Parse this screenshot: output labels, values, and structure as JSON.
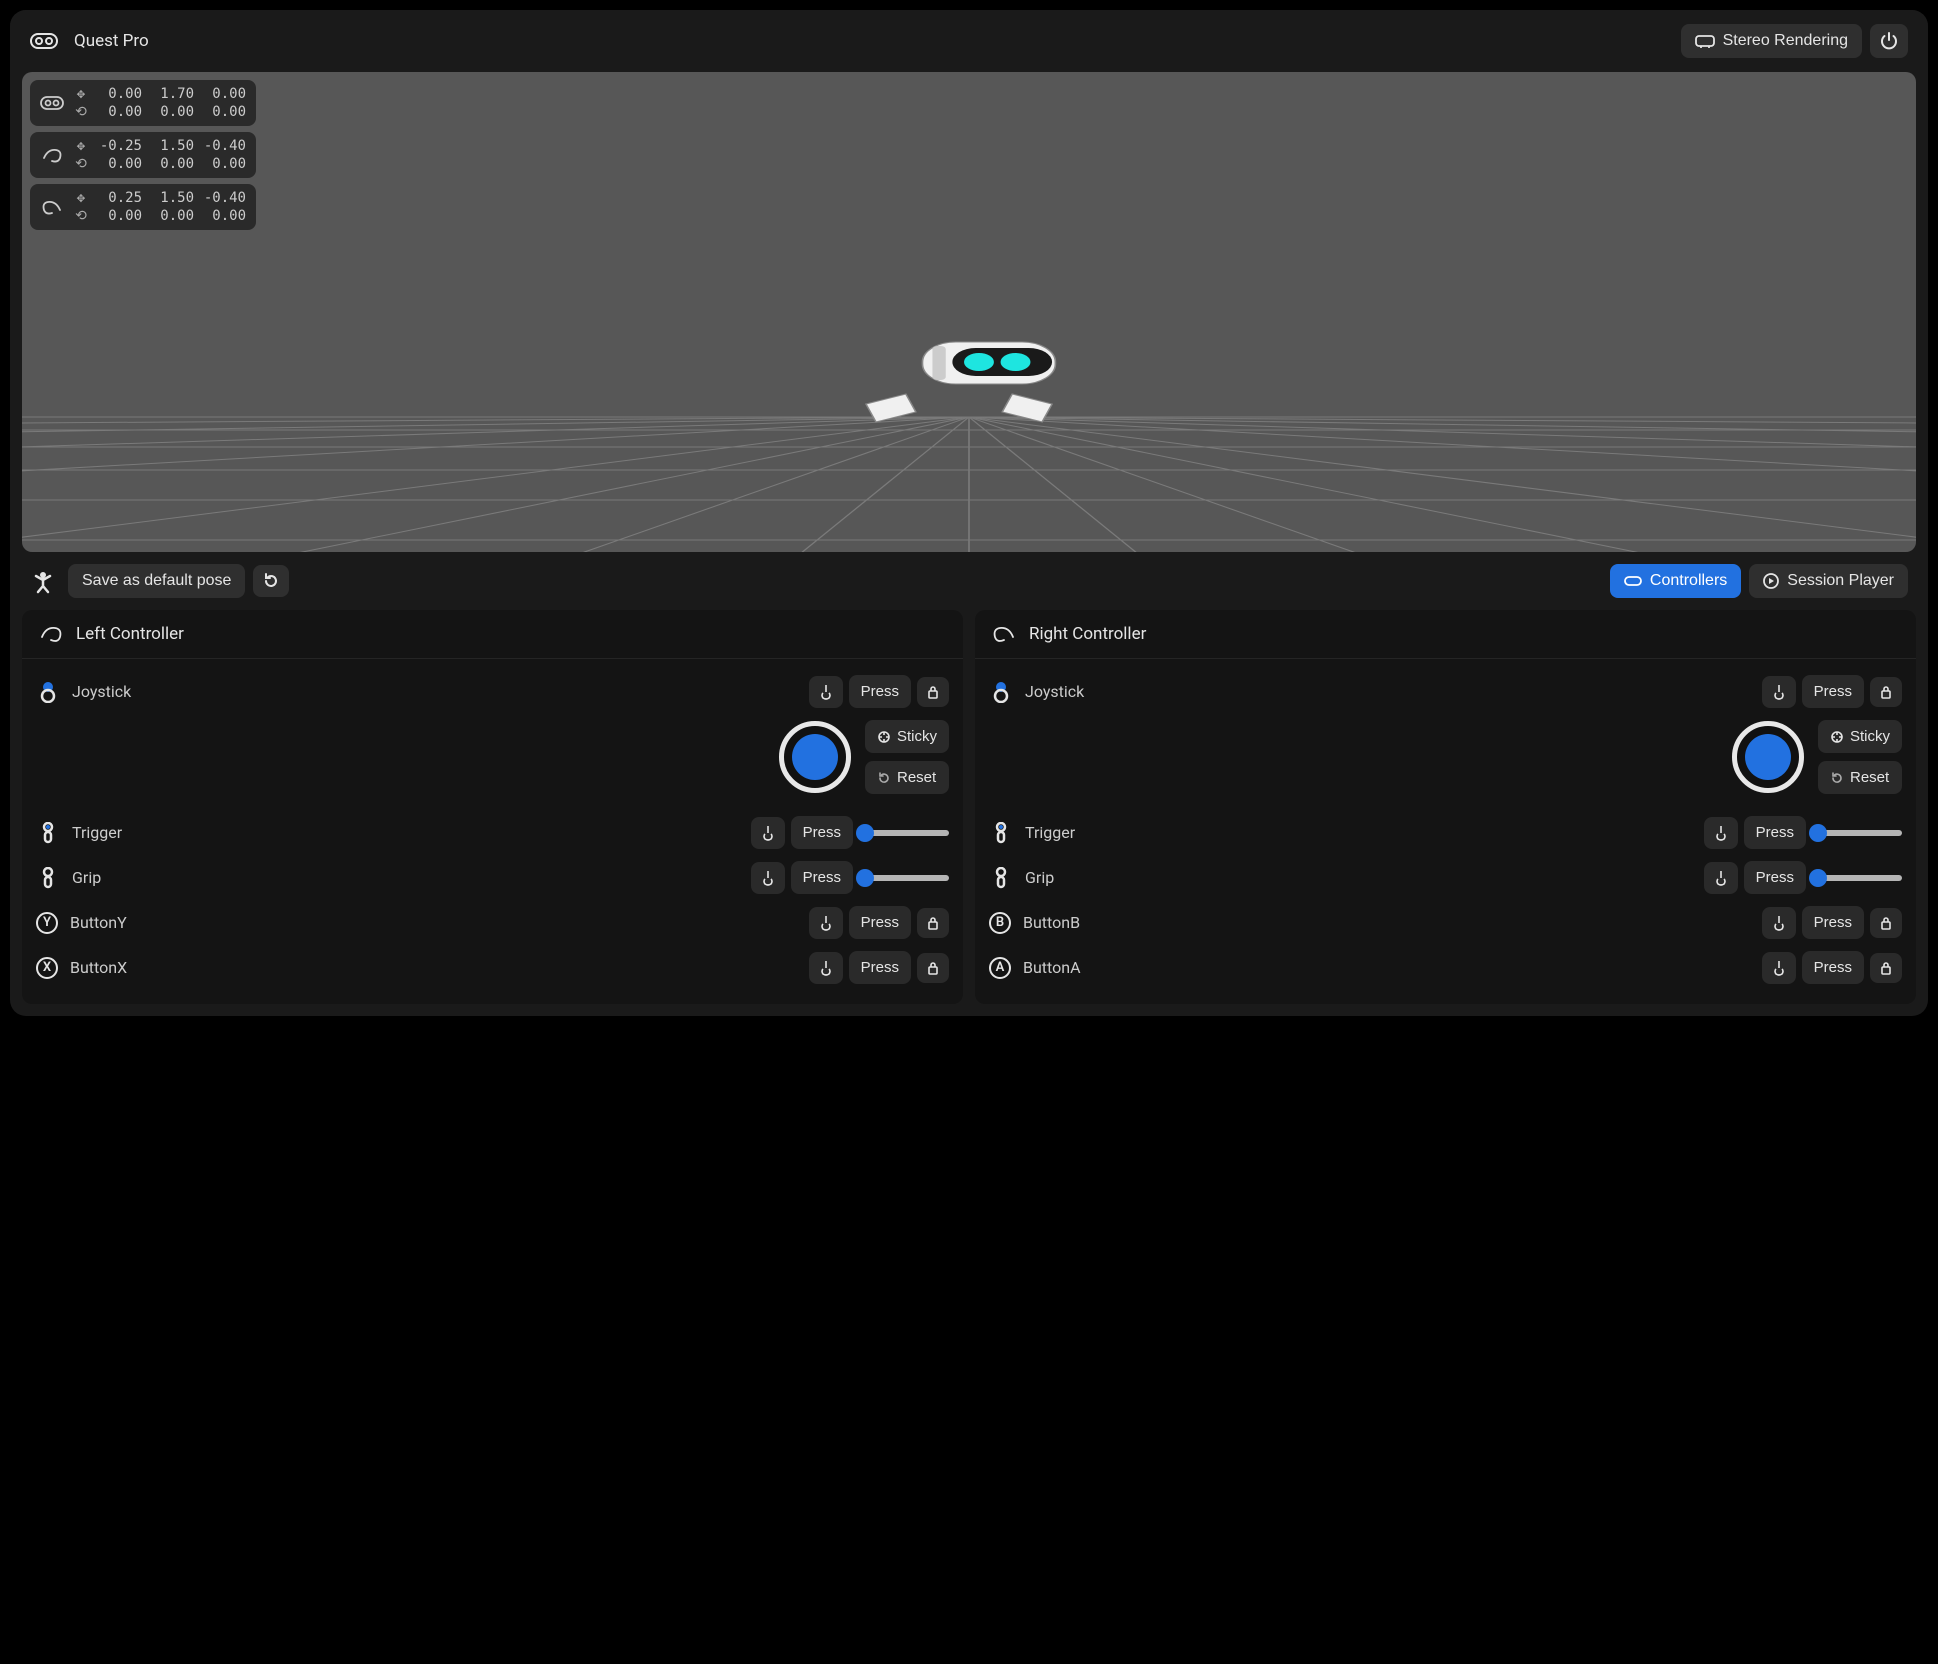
{
  "header": {
    "title": "Quest Pro",
    "stereo_label": "Stereo Rendering"
  },
  "overlays": [
    {
      "kind": "headset",
      "pos": {
        "x": "0.00",
        "y": "1.70",
        "z": "0.00"
      },
      "rot": {
        "x": "0.00",
        "y": "0.00",
        "z": "0.00"
      }
    },
    {
      "kind": "left",
      "pos": {
        "x": "-0.25",
        "y": "1.50",
        "z": "-0.40"
      },
      "rot": {
        "x": "0.00",
        "y": "0.00",
        "z": "0.00"
      }
    },
    {
      "kind": "right",
      "pos": {
        "x": "0.25",
        "y": "1.50",
        "z": "-0.40"
      },
      "rot": {
        "x": "0.00",
        "y": "0.00",
        "z": "0.00"
      }
    }
  ],
  "toolbar": {
    "save_label": "Save as default pose",
    "controllers_label": "Controllers",
    "session_player_label": "Session Player"
  },
  "panels": {
    "left": {
      "title": "Left Controller",
      "joystick_label": "Joystick",
      "press_label": "Press",
      "sticky_label": "Sticky",
      "reset_label": "Reset",
      "trigger_label": "Trigger",
      "grip_label": "Grip",
      "btn1_letter": "Y",
      "btn1_label": "ButtonY",
      "btn2_letter": "X",
      "btn2_label": "ButtonX"
    },
    "right": {
      "title": "Right Controller",
      "joystick_label": "Joystick",
      "press_label": "Press",
      "sticky_label": "Sticky",
      "reset_label": "Reset",
      "trigger_label": "Trigger",
      "grip_label": "Grip",
      "btn1_letter": "B",
      "btn1_label": "ButtonB",
      "btn2_letter": "A",
      "btn2_label": "ButtonA"
    }
  }
}
